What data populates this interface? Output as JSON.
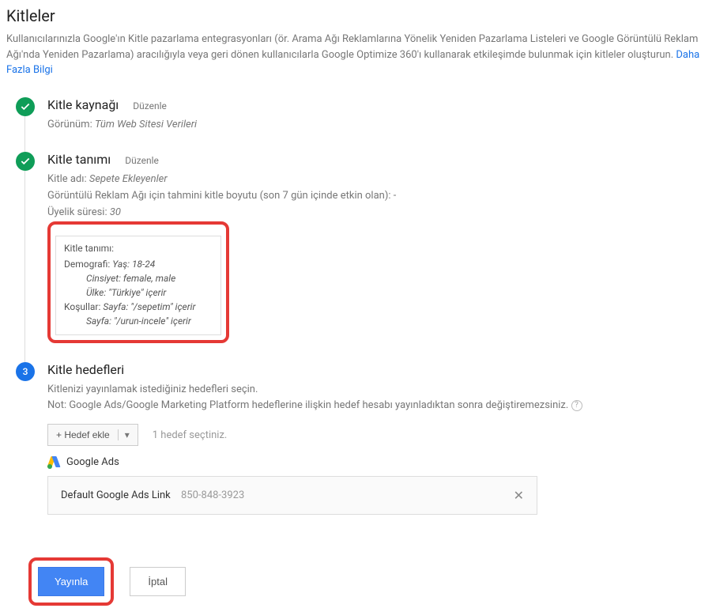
{
  "page": {
    "title": "Kitleler",
    "description": "Kullanıcılarınızla Google'ın Kitle pazarlama entegrasyonları (ör. Arama Ağı Reklamlarına Yönelik Yeniden Pazarlama Listeleri ve Google Görüntülü Reklam Ağı'nda Yeniden Pazarlama) aracılığıyla veya geri dönen kullanıcılarla Google Optimize 360'ı kullanarak etkileşimde bulunmak için kitleler oluşturun.",
    "learn_more": "Daha Fazla Bilgi"
  },
  "step1": {
    "title": "Kitle kaynağı",
    "edit": "Düzenle",
    "view_label": "Görünüm:",
    "view_value": "Tüm Web Sitesi Verileri"
  },
  "step2": {
    "title": "Kitle tanımı",
    "edit": "Düzenle",
    "name_label": "Kitle adı:",
    "name_value": "Sepete Ekleyenler",
    "size_label": "Görüntülü Reklam Ağı için tahmini kitle boyutu (son 7 gün içinde etkin olan):",
    "size_value": "-",
    "duration_label": "Üyelik süresi:",
    "duration_value": "30",
    "def_title": "Kitle tanımı:",
    "demo_label": "Demografi:",
    "age": "Yaş: 18-24",
    "gender": "Cinsiyet: female, male",
    "country": "Ülke: \"Türkiye\" içerir",
    "cond_label": "Koşullar:",
    "cond1": "Sayfa: \"/sepetim\" içerir",
    "cond2": "Sayfa: \"/urun-incele\" içerir"
  },
  "step3": {
    "number": "3",
    "title": "Kitle hedefleri",
    "desc1": "Kitlenizi yayınlamak istediğiniz hedefleri seçin.",
    "desc2": "Not: Google Ads/Google Marketing Platform hedeflerine ilişkin hedef hesabı yayınladıktan sonra değiştiremezsiniz.",
    "add_target": "+ Hedef ekle",
    "selected_count": "1 hedef seçtiniz.",
    "gads_label": "Google Ads",
    "link_name": "Default Google Ads Link",
    "link_id": "850-848-3923"
  },
  "actions": {
    "publish": "Yayınla",
    "cancel": "İptal"
  }
}
